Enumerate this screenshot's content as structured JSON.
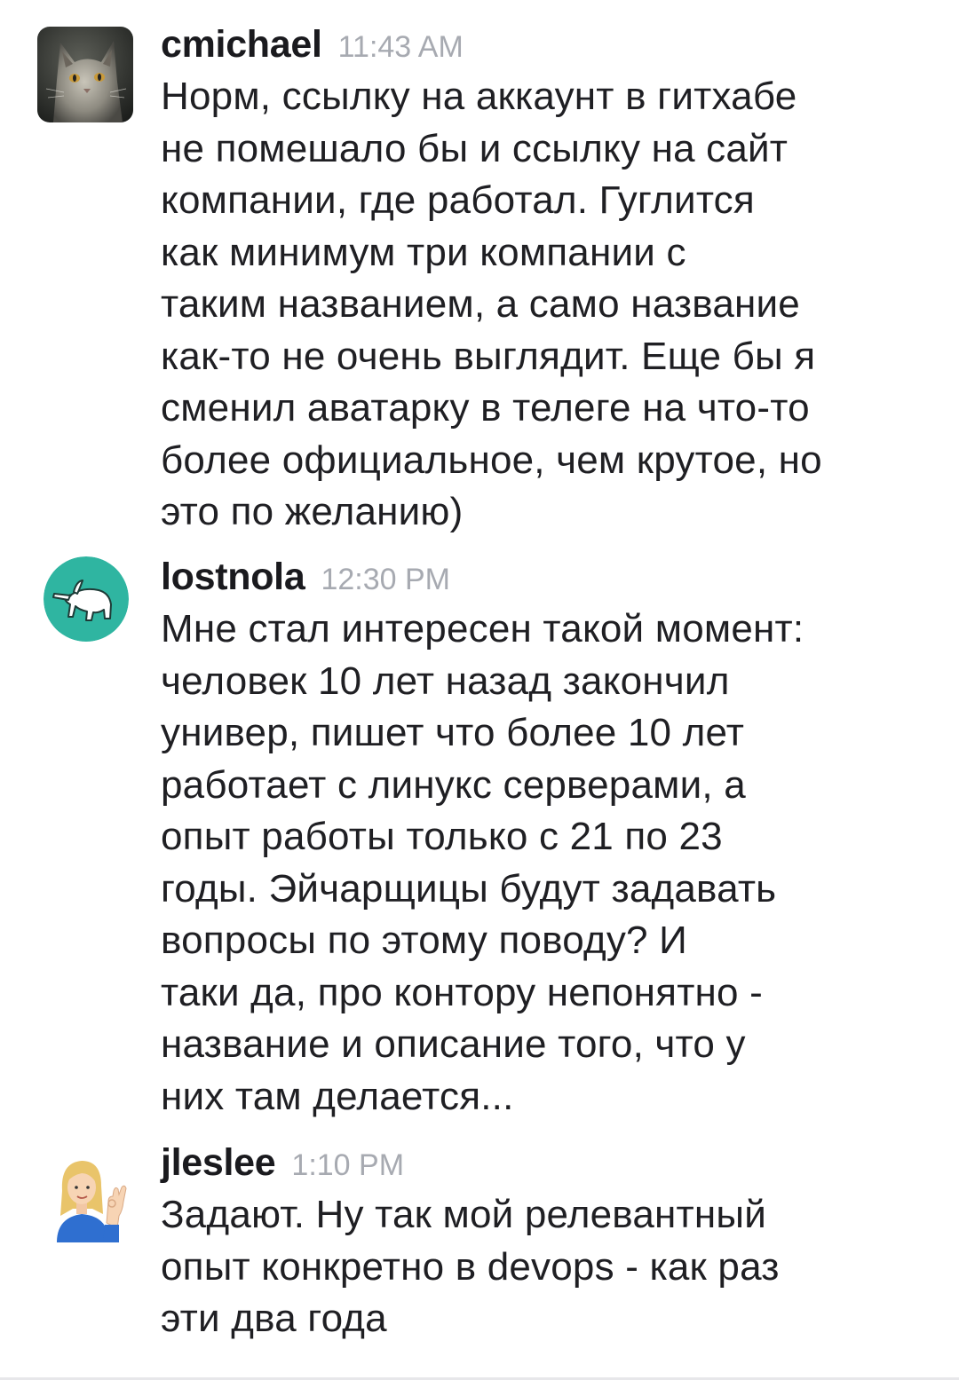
{
  "messages": [
    {
      "username": "cmichael",
      "time": "11:43 AM",
      "avatar_icon": "cat-avatar-icon",
      "lines": [
        "Норм, ссылку на аккаунт в гитхабе",
        "не помешало бы и ссылку на сайт",
        "компании, где работал. Гуглится",
        "как минимум три компании с",
        "таким названием, а само название",
        "как-то не очень выглядит. Еще бы я",
        "сменил аватарку в телеге на что-то",
        "более официальное, чем крутое, но",
        "это по желанию)"
      ]
    },
    {
      "username": "lostnola",
      "time": "12:30 PM",
      "avatar_icon": "aardvark-avatar-icon",
      "avatar_color": "#2fb5a1",
      "lines": [
        "Мне стал интересен такой момент:",
        "человек 10 лет назад закончил",
        "универ, пишет что более 10 лет",
        "работает с линукс серверами, а",
        "опыт работы только с 21 по 23",
        "годы. Эйчарщицы будут задавать",
        "вопросы по этому поводу? И",
        "таки да, про контору непонятно -",
        "название и описание того, что у",
        "них там делается..."
      ]
    },
    {
      "username": "jleslee",
      "time": "1:10 PM",
      "avatar_icon": "person-ok-gesture-avatar-icon",
      "lines": [
        "Задают. Ну так мой релевантный",
        "опыт конкретно в devops - как раз",
        "эти два года"
      ]
    }
  ],
  "colors": {
    "text": "#1f1f23",
    "timestamp": "#a7aab1",
    "avatar_teal": "#2fb5a1"
  }
}
